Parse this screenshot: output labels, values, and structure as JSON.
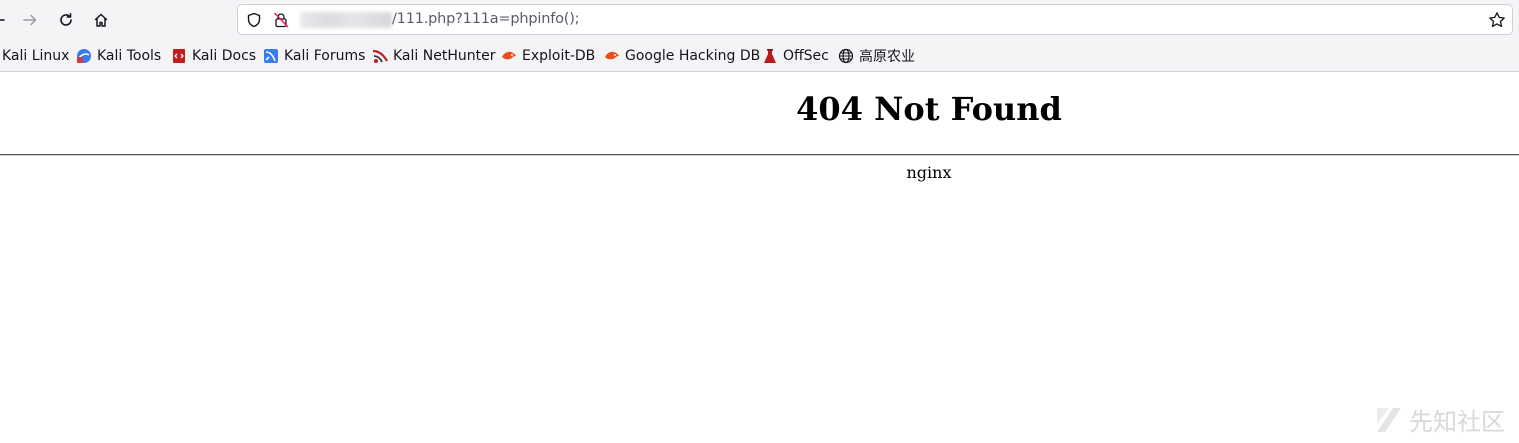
{
  "browser": {
    "url": {
      "path": "/111.php?111a=phpinfo();"
    },
    "bookmarks": [
      {
        "label": "Kali Linux",
        "icon": "kali-linux-icon"
      },
      {
        "label": "Kali Tools",
        "icon": "kali-tools-icon"
      },
      {
        "label": "Kali Docs",
        "icon": "kali-docs-icon"
      },
      {
        "label": "Kali Forums",
        "icon": "kali-forums-icon"
      },
      {
        "label": "Kali NetHunter",
        "icon": "kali-nethunter-icon"
      },
      {
        "label": "Exploit-DB",
        "icon": "exploit-db-icon"
      },
      {
        "label": "Google Hacking DB",
        "icon": "google-hacking-db-icon"
      },
      {
        "label": "OffSec",
        "icon": "offsec-icon"
      },
      {
        "label": "高原农业",
        "icon": "globe-icon"
      }
    ]
  },
  "page": {
    "heading": "404 Not Found",
    "server": "nginx"
  },
  "watermark": {
    "text": "先知社区"
  },
  "colors": {
    "toolbar_bg": "#f4f4f6",
    "url_text": "#5b5b66",
    "kali_blue": "#367bf0",
    "kali_red": "#c21d1d",
    "exploit_orange": "#e8501e"
  }
}
